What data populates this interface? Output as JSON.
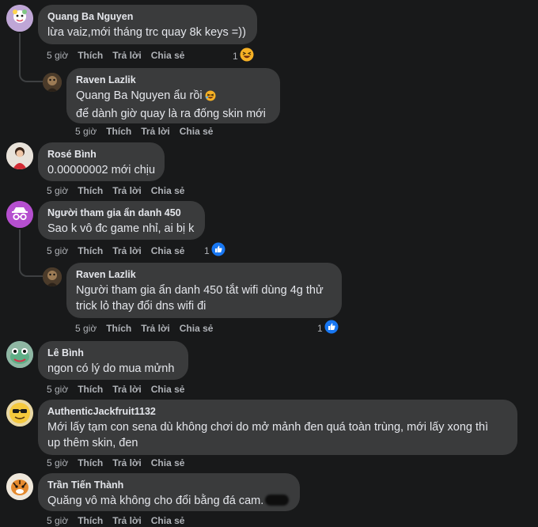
{
  "actions": {
    "time": "5 giờ",
    "like": "Thích",
    "reply": "Trả lời",
    "share": "Chia sẻ"
  },
  "comments": [
    {
      "author": "Quang Ba Nguyen",
      "lines": [
        "lừa vaiz,mới tháng trc quay 8k keys =))"
      ],
      "reaction_count": "1",
      "reaction_icon": "haha-emoji-icon"
    },
    {
      "author": "Raven Lazlik",
      "lines": [
        "Quang Ba Nguyen ẩu rồi",
        "để dành giờ quay là ra đống skin mới"
      ],
      "inline_emoji": "rofl-emoji-icon"
    },
    {
      "author": "Rosé Bình",
      "lines": [
        "0.00000002 mới chịu"
      ]
    },
    {
      "author": "Người tham gia ẩn danh 450",
      "lines": [
        "Sao k vô đc game nhỉ, ai bị k"
      ],
      "reaction_count": "1",
      "reaction_icon": "like-icon"
    },
    {
      "author": "Raven Lazlik",
      "lines": [
        "Người tham gia ẩn danh 450 tắt wifi dùng 4g thử",
        "trick lỏ thay đổi dns wifi đi"
      ],
      "reaction_count": "1",
      "reaction_icon": "like-icon"
    },
    {
      "author": "Lê Bình",
      "lines": [
        "ngon có lý do mua mửnh"
      ]
    },
    {
      "author": "AuthenticJackfruit1132",
      "lines": [
        "Mới lấy tạm con sena dù không chơi do mở mảnh đen quá toàn trùng, mới lấy xong thì",
        "up thêm skin, đen"
      ]
    },
    {
      "author": "Trần Tiến Thành",
      "lines": [
        "Quăng vô mà không cho đổi bằng đá cam."
      ]
    }
  ],
  "colors": {
    "background": "#18191a",
    "bubble": "#3a3b3c",
    "text": "#e4e6eb",
    "secondary": "#b0b3b8",
    "like_blue": "#1877f2"
  }
}
